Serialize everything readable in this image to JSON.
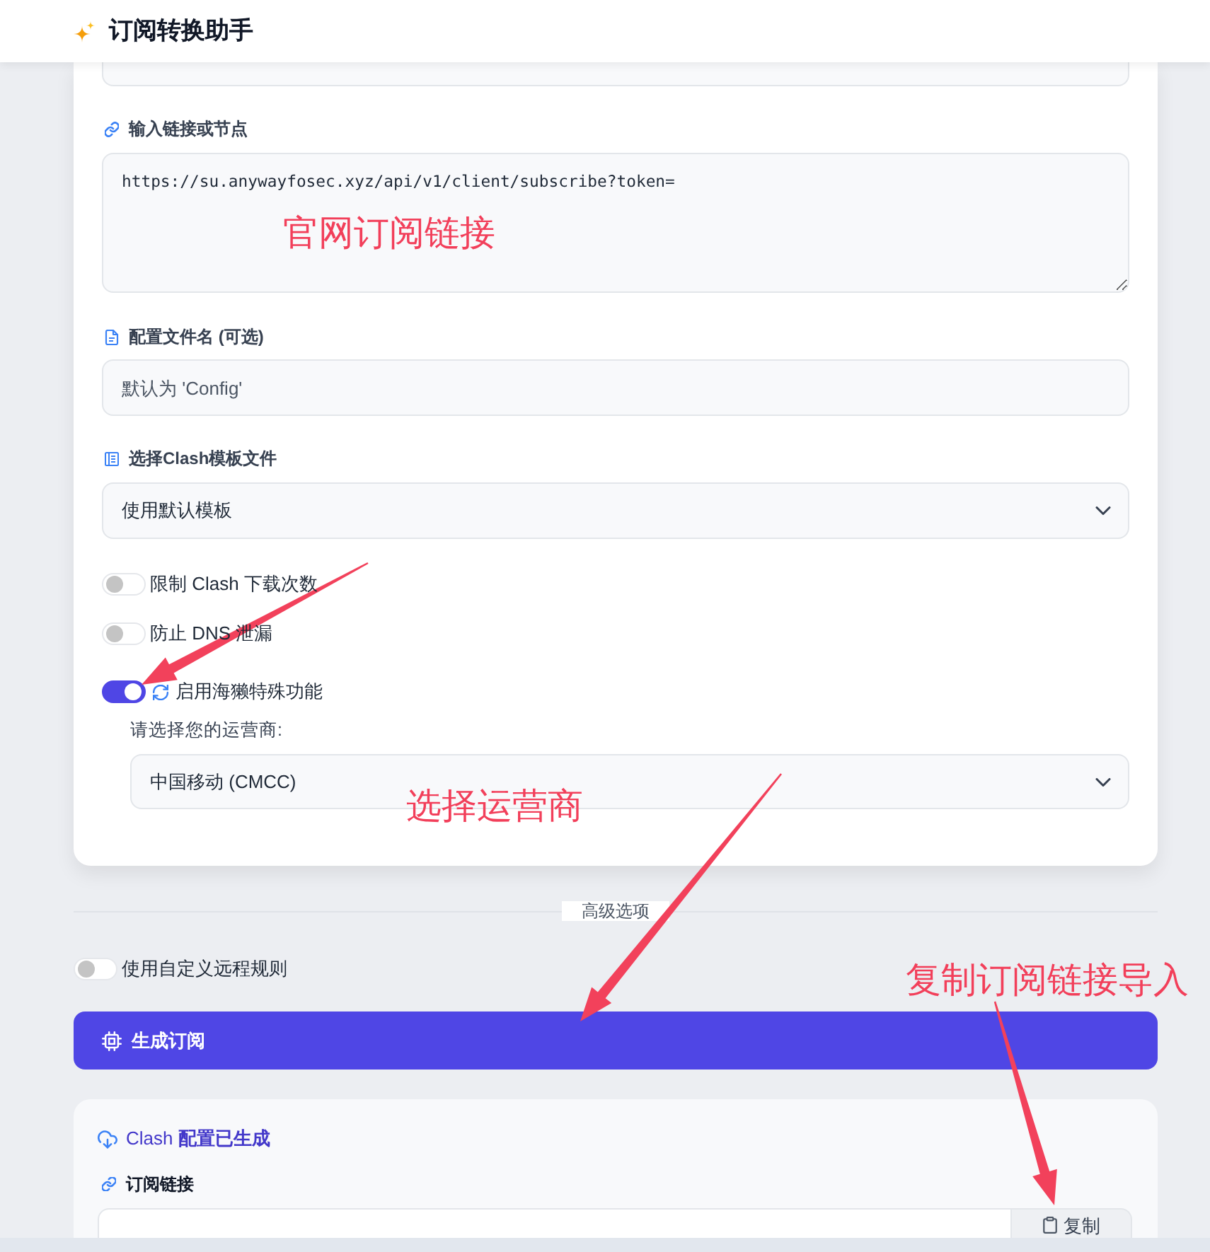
{
  "header": {
    "title": "订阅转换助手"
  },
  "form": {
    "fields": [
      {
        "kind": "textarea",
        "label": "输入链接或节点",
        "value": "https://su.anywayfosec.xyz/api/v1/client/subscribe?token="
      },
      {
        "kind": "input",
        "label": "配置文件名 (可选)",
        "placeholder": "默认为 'Config'"
      },
      {
        "kind": "select",
        "label": "选择Clash模板文件",
        "value": "使用默认模板"
      }
    ],
    "toggles": [
      {
        "kind": "toggle",
        "label": "限制 Clash 下载次数",
        "on": false
      },
      {
        "kind": "toggle",
        "label": "防止 DNS 泄漏",
        "on": false
      },
      {
        "kind": "toggle_with_icon",
        "label": "启用海獭特殊功能",
        "on": true
      }
    ],
    "operator": {
      "label": "请选择您的运营商:",
      "value": "中国移动 (CMCC)"
    }
  },
  "advanced": {
    "divider_label": "高级选项",
    "toggle": {
      "label": "使用自定义远程规则",
      "on": false
    }
  },
  "generate_button": {
    "label": "生成订阅"
  },
  "result": {
    "title": "Clash **配置已生成**",
    "link_label": "订阅链接",
    "copy_button": "复制"
  },
  "annotations": [
    "官网订阅链接",
    "选择运营商",
    "复制订阅链接导入"
  ]
}
